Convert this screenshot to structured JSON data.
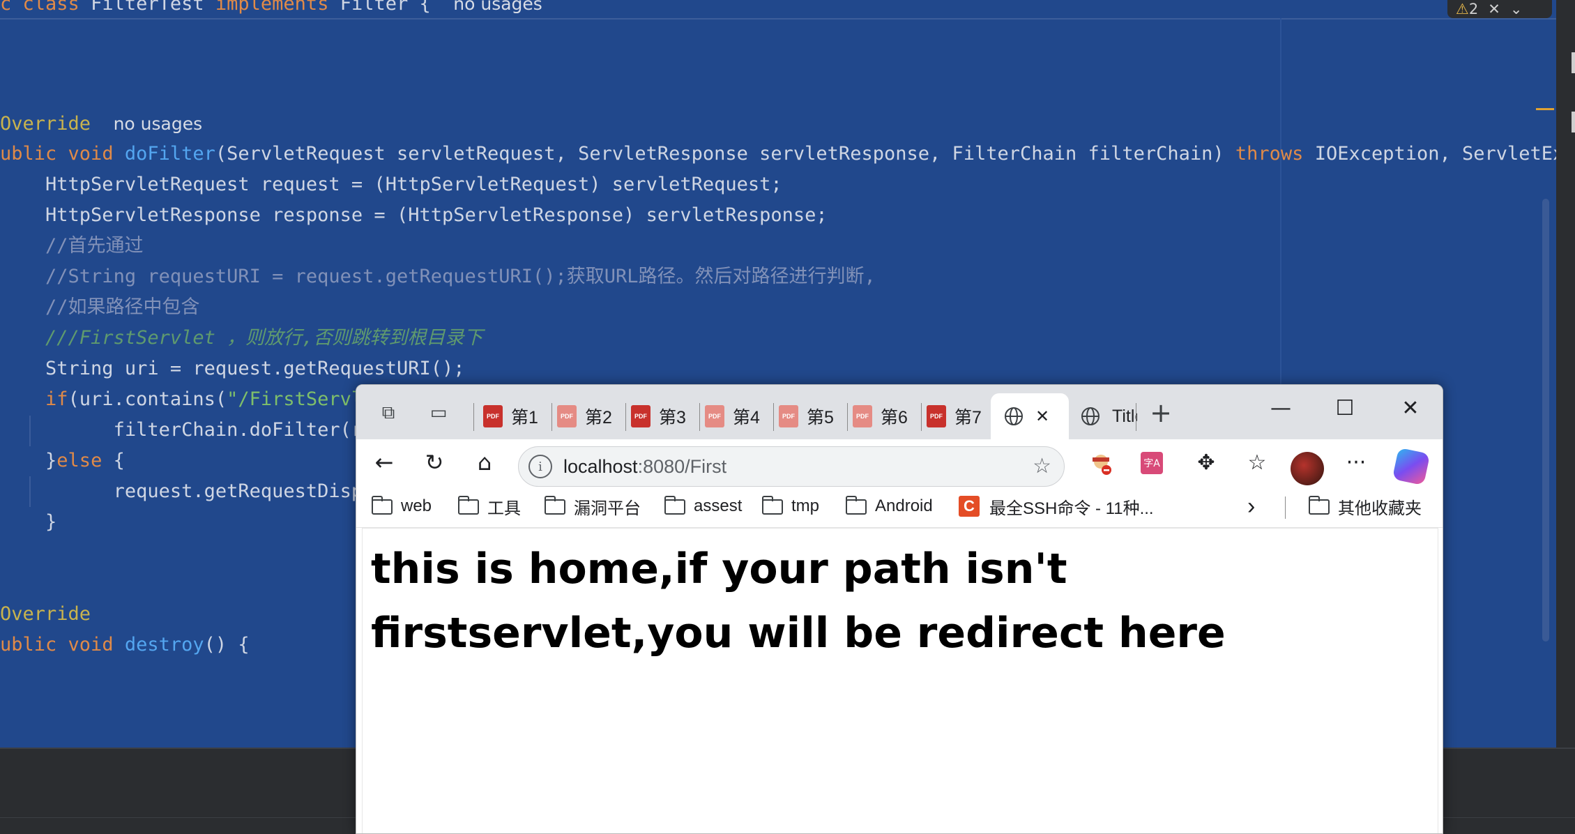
{
  "editor": {
    "top_line": {
      "class_kw": "c class",
      "class_name": "FilterTest",
      "implements_kw": "implements",
      "interface": "Filter {",
      "usages": "no usages"
    },
    "warning_badge": {
      "count": "2",
      "close": "✕",
      "chevron": "⌄"
    },
    "lines": {
      "l1_annotation": "Override",
      "l1_hint": "no usages",
      "l2_public": "ublic",
      "l2_void": "void",
      "l2_fn": "doFilter",
      "l2_params": "(ServletRequest servletRequest, ServletResponse servletResponse, FilterChain filterChain)",
      "l2_throws": "throws",
      "l2_exceptions": "IOException, ServletExce",
      "l3": "HttpServletRequest request = (HttpServletRequest) servletRequest;",
      "l4": "HttpServletResponse response = (HttpServletResponse) servletResponse;",
      "l5": "//首先通过",
      "l6": "//String requestURI = request.getRequestURI();获取URL路径。然后对路径进行判断,",
      "l7": "//如果路径中包含",
      "l8": "///FirstServlet ，则放行,否则跳转到根目录下",
      "l9": "String uri = request.getRequestURI();",
      "l10_if": "if",
      "l10_rest": "(uri.contains(",
      "l10_str": "\"/FirstServlet",
      "l11": "filterChain.doFilter(requ",
      "l12_open": "}",
      "l12_else": "else",
      "l12_brace": " {",
      "l13": "request.getRequestDispatc",
      "l14": "}",
      "l15_annotation": "Override",
      "l16_public": "ublic",
      "l16_void": "void",
      "l16_fn": "destroy",
      "l16_rest": "() {"
    }
  },
  "browser": {
    "tabs": [
      {
        "label": "第1",
        "icon": "pdf-icon"
      },
      {
        "label": "第2",
        "icon": "pdf-icon"
      },
      {
        "label": "第3",
        "icon": "pdf-icon"
      },
      {
        "label": "第4",
        "icon": "pdf-icon"
      },
      {
        "label": "第5",
        "icon": "pdf-icon"
      },
      {
        "label": "第6",
        "icon": "pdf-icon"
      },
      {
        "label": "第7",
        "icon": "pdf-icon"
      },
      {
        "label": "",
        "icon": "globe-icon",
        "active": true,
        "close": "✕"
      },
      {
        "label": "Title",
        "icon": "globe-icon"
      }
    ],
    "new_tab": "+",
    "window_controls": {
      "minimize": "—",
      "maximize": "☐",
      "close": "✕"
    },
    "address": {
      "host": "localhost",
      "rest": ":8080/First"
    },
    "bookmarks": [
      "web",
      "工具",
      "漏洞平台",
      "assest",
      "tmp",
      "Android",
      "最全SSH命令 - 11种..."
    ],
    "bookmarks_more": "›",
    "other_bookmarks": "其他收藏夹",
    "page_heading": "this is home,if your path isn't firstservlet,you will be redirect here",
    "translate_icon_text": "字A"
  }
}
